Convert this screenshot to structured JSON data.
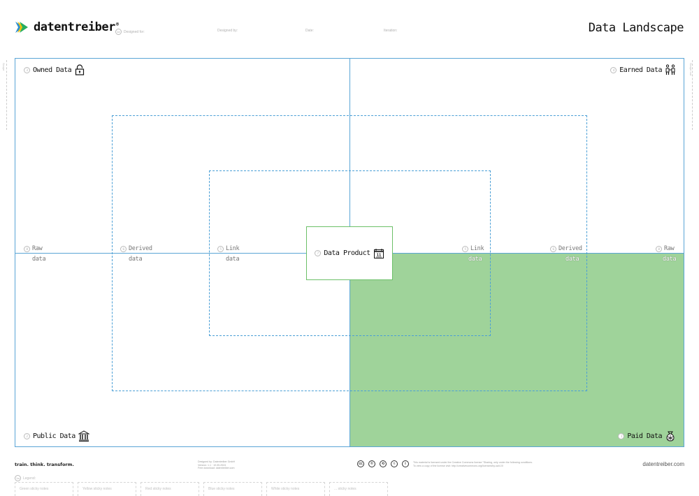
{
  "header": {
    "brand": "datentreiber",
    "brand_mark": "®",
    "meta_fields": [
      {
        "number": "1b",
        "label": "Designed for:"
      },
      {
        "number": "",
        "label": "Designed by:"
      },
      {
        "number": "",
        "label": "Date:"
      },
      {
        "number": "",
        "label": "Iteration:"
      }
    ],
    "title": "Data Landscape"
  },
  "quadrants": [
    {
      "number": "3",
      "label": "Owned Data",
      "icon": "lock-icon"
    },
    {
      "number": "4",
      "label": "Earned Data",
      "icon": "people-handshake-icon"
    },
    {
      "number": "2",
      "label": "Public Data",
      "icon": "government-building-icon"
    },
    {
      "number": "1",
      "label": "Paid Data",
      "icon": "money-bag-icon"
    }
  ],
  "colors": {
    "grid_line": "#5aa5d6",
    "paid_fill": "#9fd39a",
    "product_border": "#6cc068"
  },
  "rings_left": [
    {
      "number": "8",
      "label": "Raw",
      "sub": "data"
    },
    {
      "number": "6",
      "label": "Derived",
      "sub": "data"
    },
    {
      "number": "5",
      "label": "Link",
      "sub": "data"
    }
  ],
  "rings_right": [
    {
      "number": "5",
      "label": "Link",
      "sub": "data"
    },
    {
      "number": "6",
      "label": "Derived",
      "sub": "data"
    },
    {
      "number": "8",
      "label": "Raw",
      "sub": "data"
    }
  ],
  "center": {
    "number": "7",
    "label": "Data Product",
    "icon": "calendar-icon",
    "icon_text": "11"
  },
  "side": {
    "left": "Scope",
    "right": "Scope out"
  },
  "footer": {
    "tagline": "train. think. transform.",
    "credits": [
      "Designed by: Datentreiber GmbH",
      "Version: 1.1 · 10.05.2024",
      "Free download: datentreiber.com"
    ],
    "cc_icons": [
      "cc",
      "©",
      "⟲",
      "≈",
      "i"
    ],
    "license": [
      "This material is licensed under the Creative Commons license \"Sharing, only under the following conditions.",
      "To view a copy of the license visit: http://creativecommons.org/licenses/by-sa/4.0/"
    ],
    "site": "datentreiber.com",
    "legend_number": "1a",
    "legend_title": "Legend:",
    "legend_items": [
      "Green sticky notes",
      "Yellow sticky notes",
      "Red sticky notes",
      "Blue sticky notes",
      "White sticky notes",
      "... sticky notes"
    ]
  }
}
